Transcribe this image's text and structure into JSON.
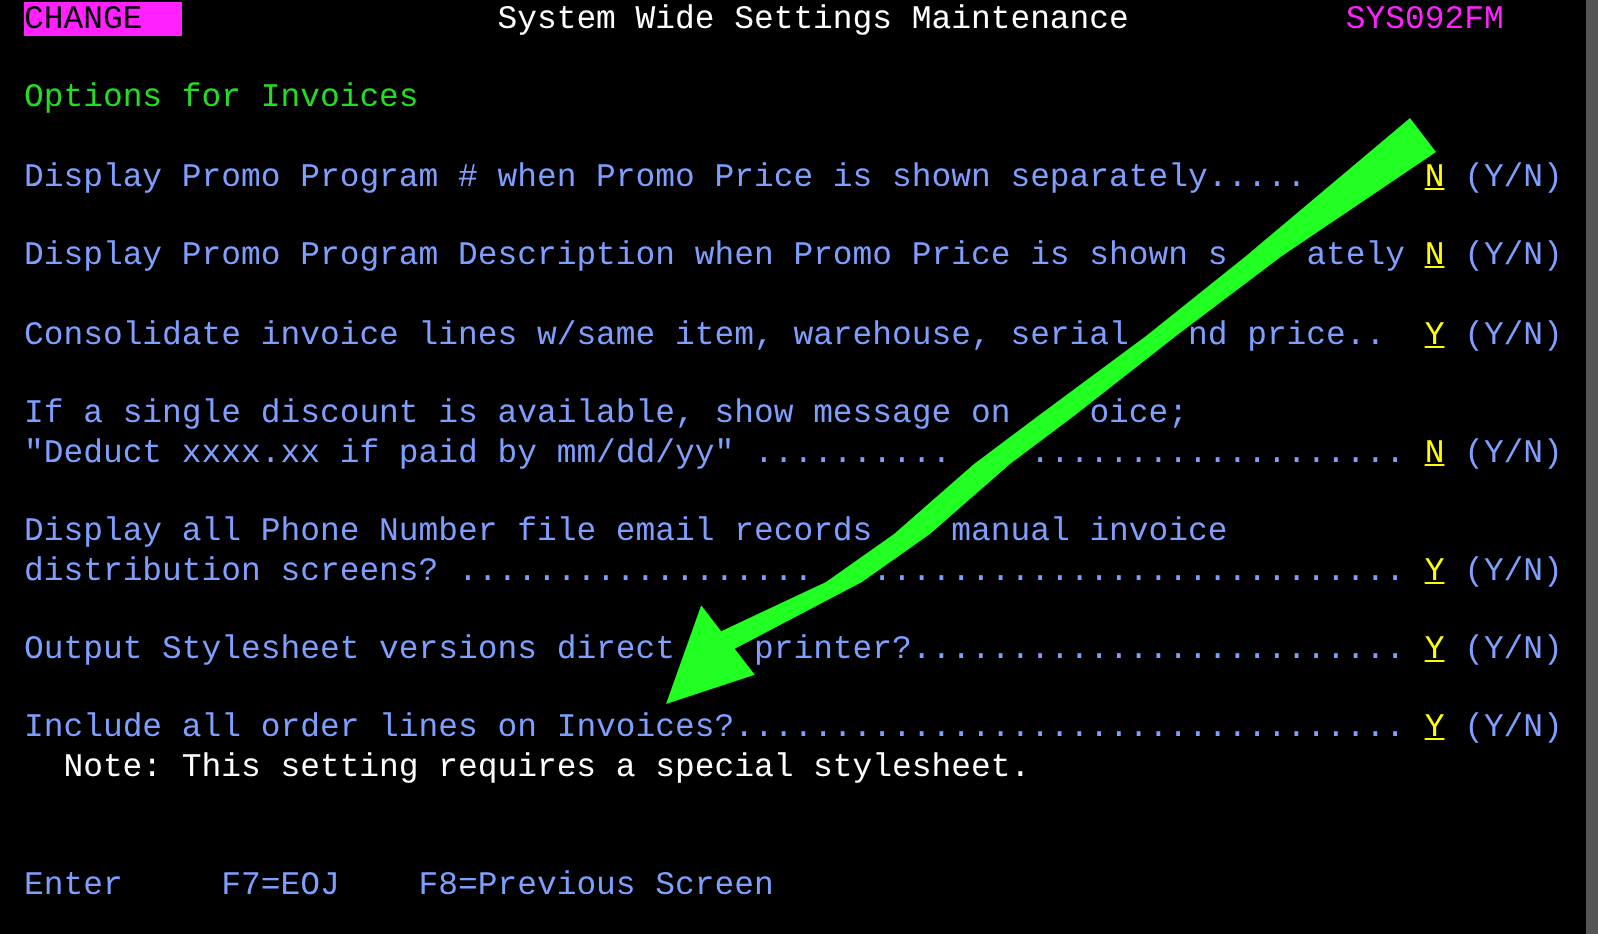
{
  "header": {
    "mode": "CHANGE",
    "title": "System Wide Settings Maintenance",
    "program": "SYS092FM"
  },
  "section_title": "Options for Invoices",
  "settings": [
    {
      "lines": [
        [
          "Display Promo Program # when Promo Price is shown separately....."
        ]
      ],
      "value": "N",
      "hint": "(Y/N)"
    },
    {
      "lines": [
        [
          "Display Promo Program Description when Promo Price is shown s",
          "    ately"
        ]
      ],
      "value": "N",
      "hint": "(Y/N)"
    },
    {
      "lines": [
        [
          "Consolidate invoice lines w/same item, warehouse, serial",
          "   nd price.."
        ]
      ],
      "value": "Y",
      "hint": "(Y/N)"
    },
    {
      "lines": [
        [
          "If a single discount is available, show message on",
          "    oice;"
        ],
        [
          "\"Deduct xxxx.xx if paid by mm/dd/yy\" ..........",
          "    ..................."
        ]
      ],
      "value": "N",
      "hint": "(Y/N)"
    },
    {
      "lines": [
        [
          "Display all Phone Number file email records",
          "    manual invoice"
        ],
        [
          "distribution screens? ..................",
          "   ..........................."
        ]
      ],
      "value": "Y",
      "hint": "(Y/N)"
    },
    {
      "lines": [
        [
          "Output Stylesheet versions direct",
          "    printer?........................."
        ]
      ],
      "value": "Y",
      "hint": "(Y/N)"
    },
    {
      "lines": [
        [
          "Include all order lines on Invoices?.................................."
        ]
      ],
      "value": "Y",
      "hint": "(Y/N)",
      "note": "Note: This setting requires a special stylesheet."
    }
  ],
  "function_keys": [
    "Enter",
    "F7=EOJ",
    "F8=Previous Screen"
  ]
}
